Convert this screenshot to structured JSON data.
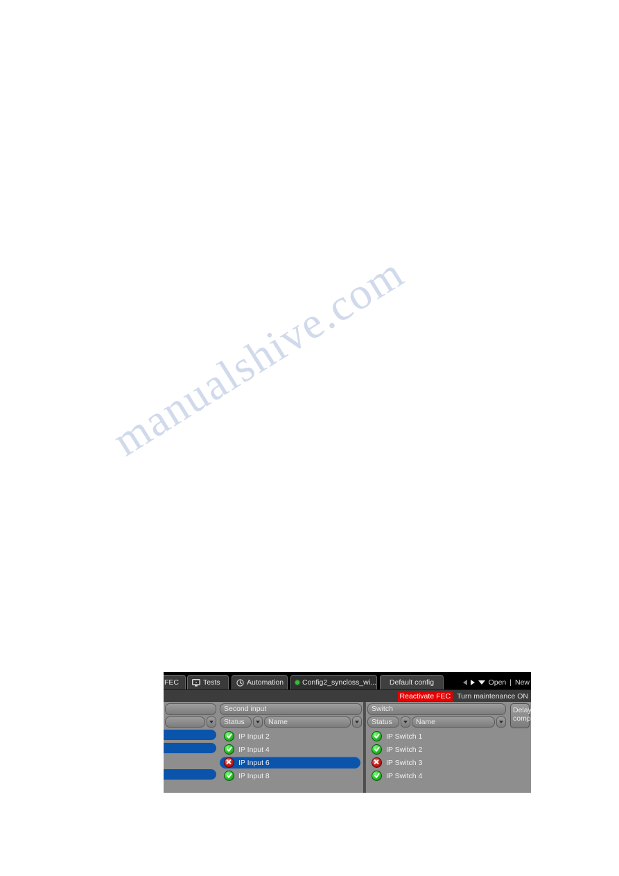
{
  "page": {
    "watermark": "manualshive.com"
  },
  "app": {
    "tabs": [
      {
        "label": "st, FEC",
        "icon": "none",
        "active": false,
        "truncated": true
      },
      {
        "label": "Tests",
        "icon": "monitor-icon",
        "active": false
      },
      {
        "label": "Automation",
        "icon": "clock-icon",
        "active": false
      },
      {
        "label": "Config2_syncloss_wi...",
        "icon": "status-dot-green",
        "active": true
      },
      {
        "label": "Default config",
        "icon": "none",
        "active": false
      }
    ],
    "nav": {
      "prev_icon": "triangle-left-icon",
      "next_icon": "triangle-right-icon",
      "dropdown_icon": "triangle-down-icon",
      "open_label": "Open",
      "separator": "|",
      "new_label": "New"
    },
    "actions": {
      "reactivate_fec": "Reactivate FEC",
      "reactivate_fec_color": "#e40000",
      "maintenance": "Turn maintenance ON"
    },
    "panes": {
      "first": {
        "group_header": "",
        "columns": [
          "",
          ""
        ]
      },
      "second": {
        "group_header": "Second input",
        "columns": [
          "Status",
          "Name"
        ],
        "rows": [
          {
            "status": "ok",
            "name": "IP Input 2",
            "selected": false
          },
          {
            "status": "ok",
            "name": "IP Input 4",
            "selected": false
          },
          {
            "status": "error",
            "name": "IP Input 6",
            "selected": true
          },
          {
            "status": "ok",
            "name": "IP Input 8",
            "selected": false
          }
        ]
      },
      "switch": {
        "group_header": "Switch",
        "columns": [
          "Status",
          "Name"
        ],
        "rows": [
          {
            "status": "ok",
            "name": "IP Switch 1",
            "selected": false
          },
          {
            "status": "ok",
            "name": "IP Switch 2",
            "selected": false
          },
          {
            "status": "error",
            "name": "IP Switch 3",
            "selected": false
          },
          {
            "status": "ok",
            "name": "IP Switch 4",
            "selected": false
          }
        ]
      },
      "delay": {
        "line1": "Delay",
        "line2": "comp."
      }
    }
  }
}
